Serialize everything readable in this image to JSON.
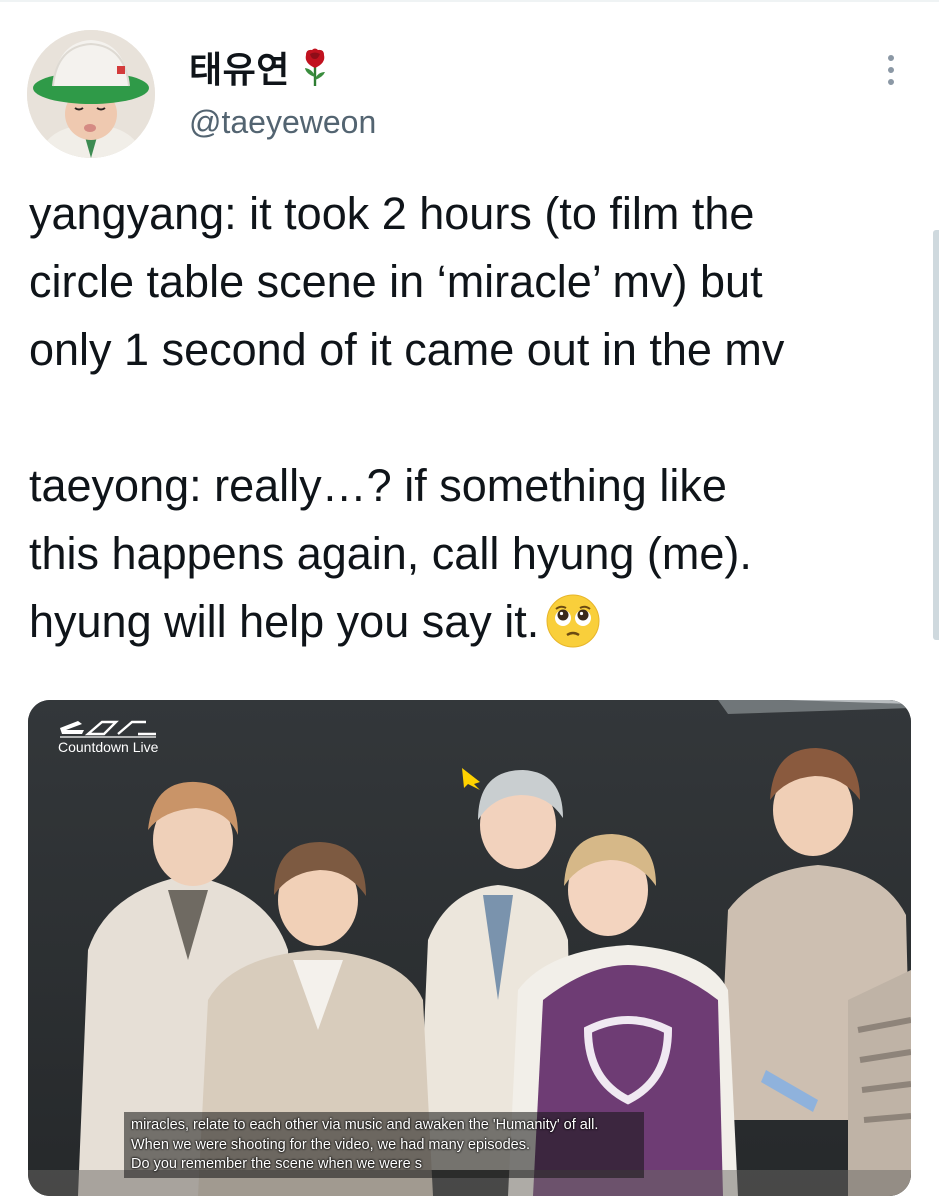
{
  "author": {
    "display_name": "태유연",
    "handle": "@taeyeweon",
    "name_emoji": "rose-icon"
  },
  "menu": {
    "icon": "more-vertical-icon"
  },
  "tweet": {
    "lines": [
      "yangyang: it took 2 hours (to film the",
      "circle table scene in ‘miracle’ mv) but",
      "only 1 second of it came out in the mv",
      "taeyong: really…? if something like",
      "this happens again, call hyung (me).",
      "hyung will help you say it."
    ],
    "trailing_emoji": "pleading-face-icon"
  },
  "media": {
    "logo_text": "Countdown Live",
    "subtitles": [
      "miracles, relate to each other via music and awaken the 'Humanity' of all.",
      "When we were shooting for the video, we had many episodes.",
      "Do you remember the scene when we were s"
    ]
  },
  "colors": {
    "text_primary": "#0f1419",
    "text_secondary": "#536471",
    "rose": "#c1121f",
    "pleading_face": "#f9cf3b"
  }
}
